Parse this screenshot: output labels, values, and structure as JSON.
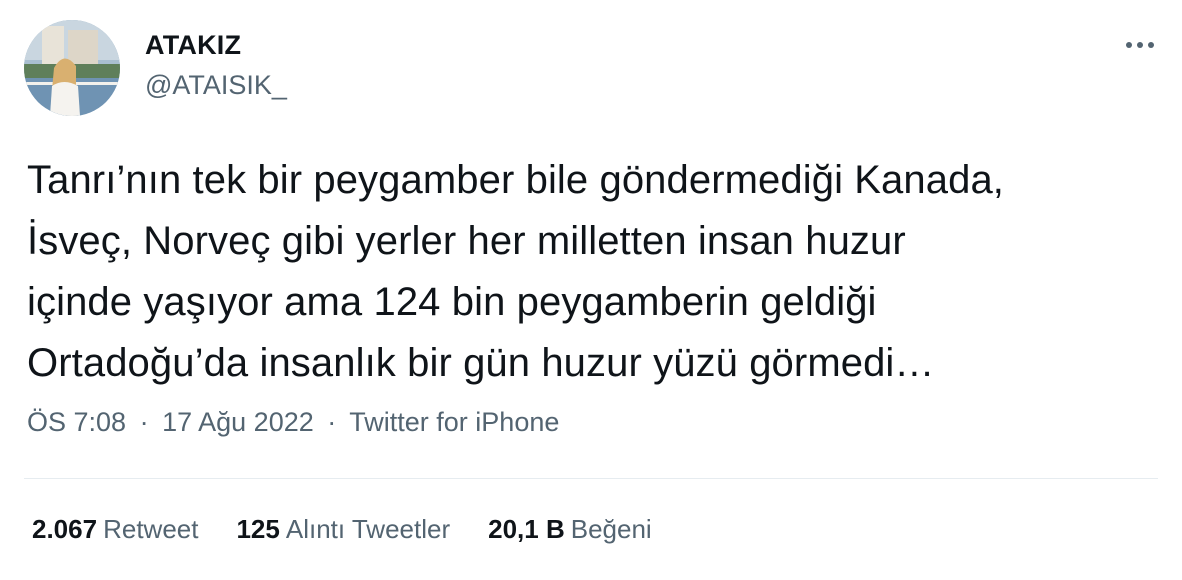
{
  "author": {
    "name": "ATAKIZ",
    "handle": "@ATAISIK_"
  },
  "icons": {
    "more": "more-horizontal-icon"
  },
  "tweet": {
    "lines": [
      "Tanrı’nın tek bir peygamber bile göndermediği Kanada,",
      "İsveç, Norveç gibi yerler her milletten insan huzur",
      "içinde yaşıyor ama 124 bin peygamberin geldiği",
      "Ortadoğu’da insanlık bir gün huzur yüzü görmedi…"
    ]
  },
  "meta": {
    "time": "ÖS 7:08",
    "separator": "·",
    "date": "17 Ağu 2022",
    "source": "Twitter for iPhone"
  },
  "stats": {
    "retweets": {
      "count": "2.067",
      "label": "Retweet"
    },
    "quotes": {
      "count": "125",
      "label": "Alıntı Tweetler"
    },
    "likes": {
      "count": "20,1 B",
      "label": "Beğeni"
    }
  },
  "colors": {
    "text": "#0f1419",
    "secondary": "#536471",
    "divider": "#e6ecf0"
  }
}
